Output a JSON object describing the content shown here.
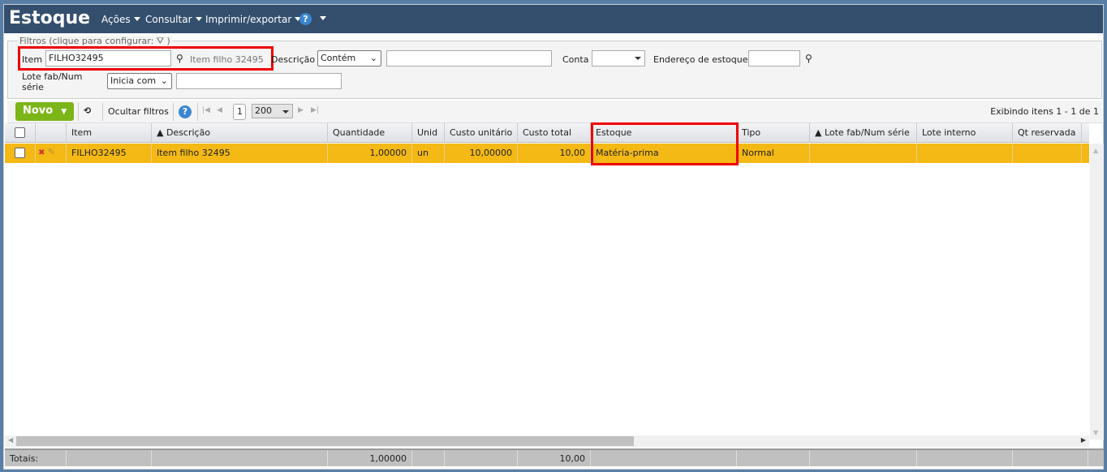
{
  "header": {
    "title": "Estoque",
    "menus": [
      "Ações",
      "Consultar",
      "Imprimir/exportar"
    ]
  },
  "filters": {
    "legend": "Filtros (clique para configurar:",
    "legend_end": ")",
    "item_label": "Item",
    "item_value": "FILHO32495",
    "item_desc": "Item filho 32495",
    "descricao_label": "Descrição",
    "descricao_op": "Contém",
    "descricao_value": "",
    "conta_label": "Conta",
    "conta_value": "",
    "endereco_label": "Endereço de estoque",
    "endereco_value": "",
    "lote_label_1": "Lote fab/Num",
    "lote_label_2": "série",
    "lote_op": "Inicia com",
    "lote_value": ""
  },
  "toolbar": {
    "novo": "Novo",
    "ocultar": "Ocultar filtros",
    "page": "1",
    "page_size": "200",
    "status": "Exibindo itens 1 - 1 de 1"
  },
  "columns": [
    "Item",
    "▲ Descrição",
    "Quantidade",
    "Unid",
    "Custo unitário",
    "Custo total",
    "Estoque",
    "Tipo",
    "▲ Lote fab/Num série",
    "Lote interno",
    "Qt reservada"
  ],
  "rows": [
    {
      "item": "FILHO32495",
      "descricao": "Item filho 32495",
      "quantidade": "1,00000",
      "unid": "un",
      "custo_unitario": "10,00000",
      "custo_total": "10,00",
      "estoque": "Matéria-prima",
      "tipo": "Normal",
      "lote_fab": "",
      "lote_interno": "",
      "qt_reservada": ""
    }
  ],
  "totals": {
    "label": "Totais:",
    "quantidade": "1,00000",
    "custo_total": "10,00"
  }
}
